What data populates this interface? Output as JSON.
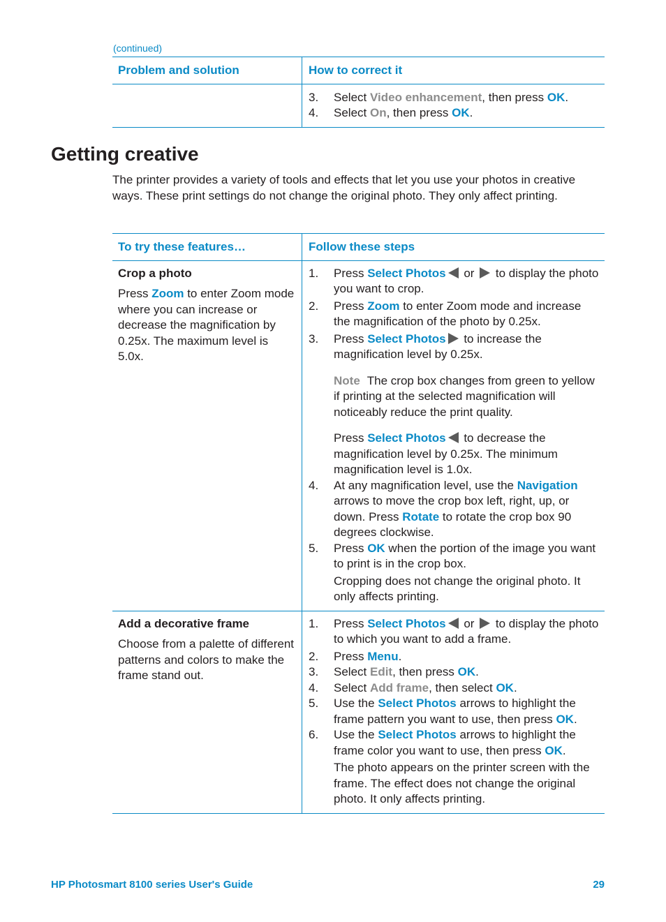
{
  "continued_label": "(continued)",
  "troubleshoot_table": {
    "headers": [
      "Problem and solution",
      "How to correct it"
    ],
    "steps": [
      {
        "num": "3.",
        "parts": [
          "Select ",
          "Video enhancement",
          ", then press ",
          "OK",
          "."
        ]
      },
      {
        "num": "4.",
        "parts": [
          "Select ",
          "On",
          ", then press ",
          "OK",
          "."
        ]
      }
    ]
  },
  "section": {
    "title": "Getting creative",
    "intro": "The printer provides a variety of tools and effects that let you use your photos in creative ways. These print settings do not change the original photo. They only affect printing."
  },
  "features_table": {
    "headers": [
      "To try these features…",
      "Follow these steps"
    ],
    "crop": {
      "title": "Crop a photo",
      "desc_parts": [
        "Press ",
        "Zoom",
        " to enter Zoom mode where you can increase or decrease the magnification by 0.25x. The maximum level is 5.0x."
      ],
      "step1": {
        "num": "1.",
        "a": "Press ",
        "b": "Select Photos",
        "c": " or ",
        "d": " to display the photo you want to crop.",
        "icon_left": "left-arrow-icon",
        "icon_right": "right-arrow-icon"
      },
      "step2": {
        "num": "2.",
        "a": "Press ",
        "b": "Zoom",
        "c": " to enter Zoom mode and increase the magnification of the photo by 0.25x."
      },
      "step3": {
        "num": "3.",
        "a": "Press ",
        "b": "Select Photos",
        "c": " to increase the magnification level by 0.25x."
      },
      "note": {
        "label": "Note",
        "text": "The crop box changes from green to yellow if printing at the selected magnification will noticeably reduce the print quality."
      },
      "decrease": {
        "a": "Press ",
        "b": "Select Photos",
        "c": " to decrease the magnification level by 0.25x. The minimum magnification level is 1.0x."
      },
      "step4": {
        "num": "4.",
        "a": "At any magnification level, use the ",
        "b": "Navigation",
        "c": " arrows to move the crop box left, right, up, or down. Press ",
        "d": "Rotate",
        "e": " to rotate the crop box 90 degrees clockwise."
      },
      "step5": {
        "num": "5.",
        "a": "Press ",
        "b": "OK",
        "c": " when the portion of the image you want to print is in the crop box."
      },
      "footnote": "Cropping does not change the original photo. It only affects printing."
    },
    "frame": {
      "title": "Add a decorative frame",
      "desc": "Choose from a palette of different patterns and colors to make the frame stand out.",
      "step1": {
        "num": "1.",
        "a": "Press ",
        "b": "Select Photos",
        "c": " or ",
        "d": " to display the photo to which you want to add a frame."
      },
      "step2": {
        "num": "2.",
        "a": "Press ",
        "b": "Menu",
        "c": "."
      },
      "step3": {
        "num": "3.",
        "a": "Select ",
        "b": "Edit",
        "c": ", then press ",
        "d": "OK",
        "e": "."
      },
      "step4": {
        "num": "4.",
        "a": "Select ",
        "b": "Add frame",
        "c": ", then select ",
        "d": "OK",
        "e": "."
      },
      "step5": {
        "num": "5.",
        "a": "Use the ",
        "b": "Select Photos",
        "c": " arrows to highlight the frame pattern you want to use, then press ",
        "d": "OK",
        "e": "."
      },
      "step6": {
        "num": "6.",
        "a": "Use the ",
        "b": "Select Photos",
        "c": " arrows to highlight the frame color you want to use, then press ",
        "d": "OK",
        "e": "."
      },
      "footnote": "The photo appears on the printer screen with the frame. The effect does not change the original photo. It only affects printing."
    }
  },
  "footer": {
    "title": "HP Photosmart 8100 series User's Guide",
    "page": "29"
  },
  "colors": {
    "accent": "#0a8ac6",
    "menu_item": "#8c8c8c",
    "text": "#231f20"
  }
}
